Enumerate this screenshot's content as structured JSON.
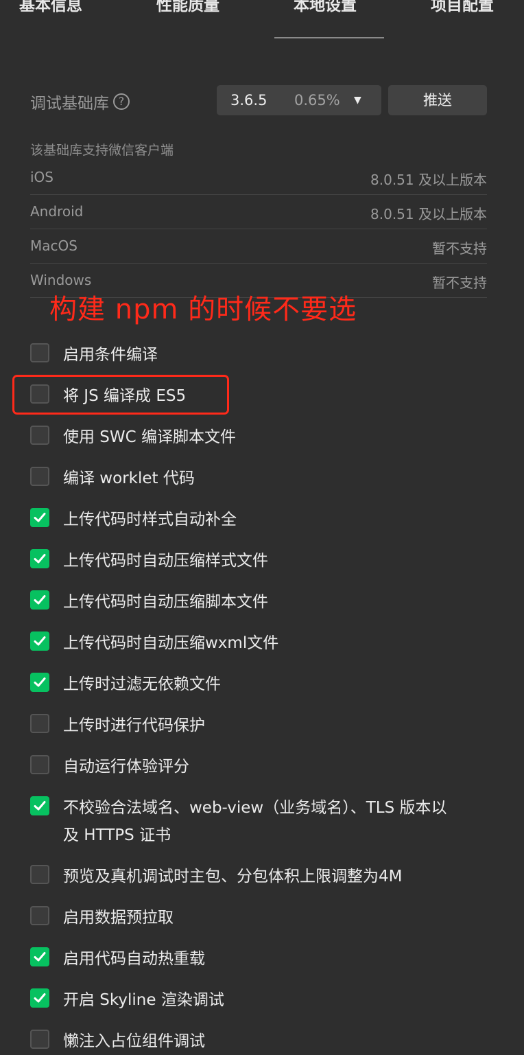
{
  "tabs": [
    {
      "label": "基本信息"
    },
    {
      "label": "性能质量"
    },
    {
      "label": "本地设置"
    },
    {
      "label": "项目配置"
    }
  ],
  "active_tab": "本地设置",
  "library": {
    "label": "调试基础库",
    "help_icon": "?",
    "version": "3.6.5",
    "percent": "0.65%",
    "caret": "▼",
    "push_label": "推送"
  },
  "support": {
    "title": "该基础库支持微信客户端",
    "rows": [
      {
        "platform": "iOS",
        "requirement": "8.0.51 及以上版本"
      },
      {
        "platform": "Android",
        "requirement": "8.0.51 及以上版本"
      },
      {
        "platform": "MacOS",
        "requirement": "暂不支持"
      },
      {
        "platform": "Windows",
        "requirement": "暂不支持"
      }
    ]
  },
  "annotation": {
    "text": "构建 npm 的时候不要选",
    "color": "#ff2a1a"
  },
  "colors": {
    "checked": "#07c160",
    "background": "#2e2e2e"
  },
  "options": [
    {
      "label": "启用条件编译",
      "checked": false
    },
    {
      "label": "将 JS 编译成 ES5",
      "checked": false
    },
    {
      "label": "使用 SWC 编译脚本文件",
      "checked": false
    },
    {
      "label": "编译 worklet 代码",
      "checked": false
    },
    {
      "label": "上传代码时样式自动补全",
      "checked": true
    },
    {
      "label": "上传代码时自动压缩样式文件",
      "checked": true
    },
    {
      "label": "上传代码时自动压缩脚本文件",
      "checked": true
    },
    {
      "label": "上传代码时自动压缩wxml文件",
      "checked": true
    },
    {
      "label": "上传时过滤无依赖文件",
      "checked": true
    },
    {
      "label": "上传时进行代码保护",
      "checked": false
    },
    {
      "label": "自动运行体验评分",
      "checked": false
    },
    {
      "label": "不校验合法域名、web-view（业务域名）、TLS 版本以及 HTTPS 证书",
      "checked": true
    },
    {
      "label": "预览及真机调试时主包、分包体积上限调整为4M",
      "checked": false
    },
    {
      "label": "启用数据预拉取",
      "checked": false
    },
    {
      "label": "启用代码自动热重载",
      "checked": true
    },
    {
      "label": "开启 Skyline 渲染调试",
      "checked": true
    },
    {
      "label": "懒注入占位组件调试",
      "checked": false
    }
  ]
}
